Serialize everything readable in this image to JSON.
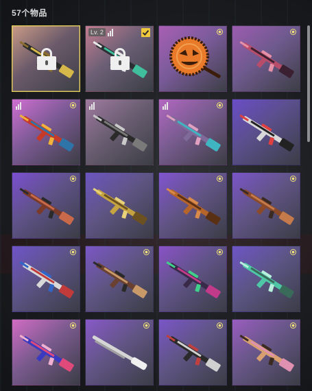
{
  "header": {
    "item_count_label": "57个物品"
  },
  "inventory": {
    "items": [
      {
        "type": "rifle",
        "bg": [
          "#c99a86",
          "#6b5a6a",
          "#3c3f46"
        ],
        "selected": true,
        "locked": true,
        "glyph": "♠",
        "palette": [
          "#2b2b2b",
          "#d7b94b",
          "#8a6c2e"
        ]
      },
      {
        "type": "rifle",
        "bg": [
          "#c57d90",
          "#6b5f75",
          "#3b3e45"
        ],
        "locked": true,
        "level": "Lv. 2",
        "bars": true,
        "checked": true,
        "palette": [
          "#2a2f33",
          "#3fbf9b",
          "#e8e8e8"
        ]
      },
      {
        "type": "pan",
        "bg": [
          "#a95fb4",
          "#7a5b9a",
          "#3d3f47"
        ],
        "rare": true,
        "palette": [
          "#e87a2a",
          "#3b1d0a",
          "#f0a050"
        ]
      },
      {
        "type": "rifle",
        "bg": [
          "#9c5cb0",
          "#6f5a8e",
          "#3c3e45"
        ],
        "rare": true,
        "palette": [
          "#b74d6a",
          "#3a2030",
          "#e690a8"
        ]
      },
      {
        "type": "rifle",
        "bg": [
          "#d06fd1",
          "#7c5a95",
          "#3c3e45"
        ],
        "bars": true,
        "rare": true,
        "palette": [
          "#c63a2a",
          "#2e74a8",
          "#f0b23b"
        ]
      },
      {
        "type": "rifle",
        "bg": [
          "#a07aa0",
          "#6a5e72",
          "#3c3e45"
        ],
        "bars": true,
        "palette": [
          "#2b2b2b",
          "#7a7a7a",
          "#c9c9c9"
        ]
      },
      {
        "type": "rifle",
        "bg": [
          "#b468c2",
          "#775b8e",
          "#3c3e45"
        ],
        "bars": true,
        "rare": true,
        "palette": [
          "#7f6b9a",
          "#3fb5c2",
          "#e0a0c0"
        ]
      },
      {
        "type": "rifle",
        "bg": [
          "#6a4dc7",
          "#5a4f8a",
          "#3b3d46"
        ],
        "palette": [
          "#d9d9d9",
          "#222222",
          "#e04040"
        ]
      },
      {
        "type": "rifle",
        "bg": [
          "#7b4fd0",
          "#5e5286",
          "#3b3d46"
        ],
        "rare": true,
        "palette": [
          "#7a3a2a",
          "#c86a4a",
          "#2a2a2a"
        ]
      },
      {
        "type": "rifle",
        "bg": [
          "#6c55c0",
          "#5f5584",
          "#3b3d46"
        ],
        "palette": [
          "#c5a341",
          "#6b5020",
          "#e8d27a"
        ]
      },
      {
        "type": "rifle",
        "bg": [
          "#8154d1",
          "#625486",
          "#3b3d46"
        ],
        "rare": true,
        "palette": [
          "#b5642a",
          "#5a3015",
          "#d88a4a"
        ]
      },
      {
        "type": "rifle",
        "bg": [
          "#7a55c8",
          "#605484",
          "#3b3d46"
        ],
        "rare": true,
        "palette": [
          "#8a4a2a",
          "#c47a4a",
          "#3a2a22"
        ]
      },
      {
        "type": "rifle",
        "bg": [
          "#6f54c9",
          "#5c5385",
          "#3b3d46"
        ],
        "rare": true,
        "palette": [
          "#d8d8d8",
          "#c23b3b",
          "#2f66c8"
        ]
      },
      {
        "type": "rifle",
        "bg": [
          "#7b57c6",
          "#5f5584",
          "#3b3d46"
        ],
        "rare": true,
        "palette": [
          "#6a4030",
          "#c89a6a",
          "#2a2a2a"
        ]
      },
      {
        "type": "rifle",
        "bg": [
          "#8a52c7",
          "#5f5386",
          "#3b3d46"
        ],
        "rare": true,
        "palette": [
          "#3a2a4a",
          "#c23a8a",
          "#3fd08a"
        ]
      },
      {
        "type": "rifle",
        "bg": [
          "#6e55c6",
          "#5c5585",
          "#3b3d46"
        ],
        "rare": true,
        "palette": [
          "#4fc7a6",
          "#3a6a5a",
          "#b8f0de"
        ]
      },
      {
        "type": "rifle",
        "bg": [
          "#d26cc4",
          "#7a5a8e",
          "#3b3d46"
        ],
        "rare": true,
        "palette": [
          "#3a3ac0",
          "#e04a7a",
          "#f0b0d0"
        ]
      },
      {
        "type": "shotgun",
        "bg": [
          "#8858c8",
          "#625586",
          "#3b3d46"
        ],
        "rare": true,
        "palette": [
          "#d5d5d5",
          "#a0a0a0",
          "#f0f0f0"
        ]
      },
      {
        "type": "rifle",
        "bg": [
          "#7a55c8",
          "#5f5584",
          "#3b3d46"
        ],
        "rare": true,
        "palette": [
          "#2a2a2a",
          "#d0d0d0",
          "#c04040"
        ]
      },
      {
        "type": "rifle",
        "bg": [
          "#9a5dc0",
          "#665686",
          "#3b3d46"
        ],
        "rare": true,
        "palette": [
          "#d8a070",
          "#e090b0",
          "#3a2a22"
        ]
      }
    ]
  }
}
